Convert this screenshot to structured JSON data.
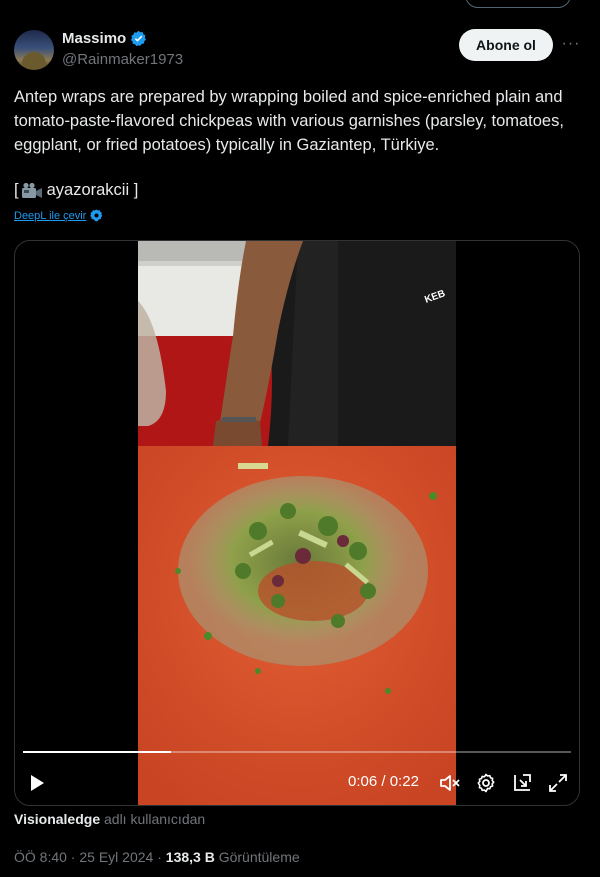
{
  "author": {
    "name": "Massimo",
    "handle": "@Rainmaker1973"
  },
  "follow_label": "Abone ol",
  "more_label": "···",
  "tweet": {
    "text": "Antep wraps are prepared by wrapping boiled and spice-enriched plain and tomato-paste-flavored chickpeas with various garnishes (parsley, tomatoes, eggplant, or fried potatoes) typically in Gaziantep, Türkiye.",
    "credit_open": "[",
    "credit_user": " ayazorakcii ]",
    "translate_label": "DeepL ile çevir"
  },
  "video": {
    "current_time": "0:06",
    "separator": " / ",
    "duration": "0:22",
    "progress": 0.27,
    "apron_text": "KEB"
  },
  "attribution": {
    "user": "Visionaledge",
    "suffix": "adlı kullanıcıdan"
  },
  "meta": {
    "time": "ÖÖ 8:40",
    "sep1": " · ",
    "date": "25 Eyl 2024",
    "sep2": " · ",
    "views": "138,3 B",
    "views_label": " Görüntüleme"
  },
  "colors": {
    "accent": "#1d9bf0",
    "background": "#000000",
    "secondary_text": "#71767b"
  }
}
